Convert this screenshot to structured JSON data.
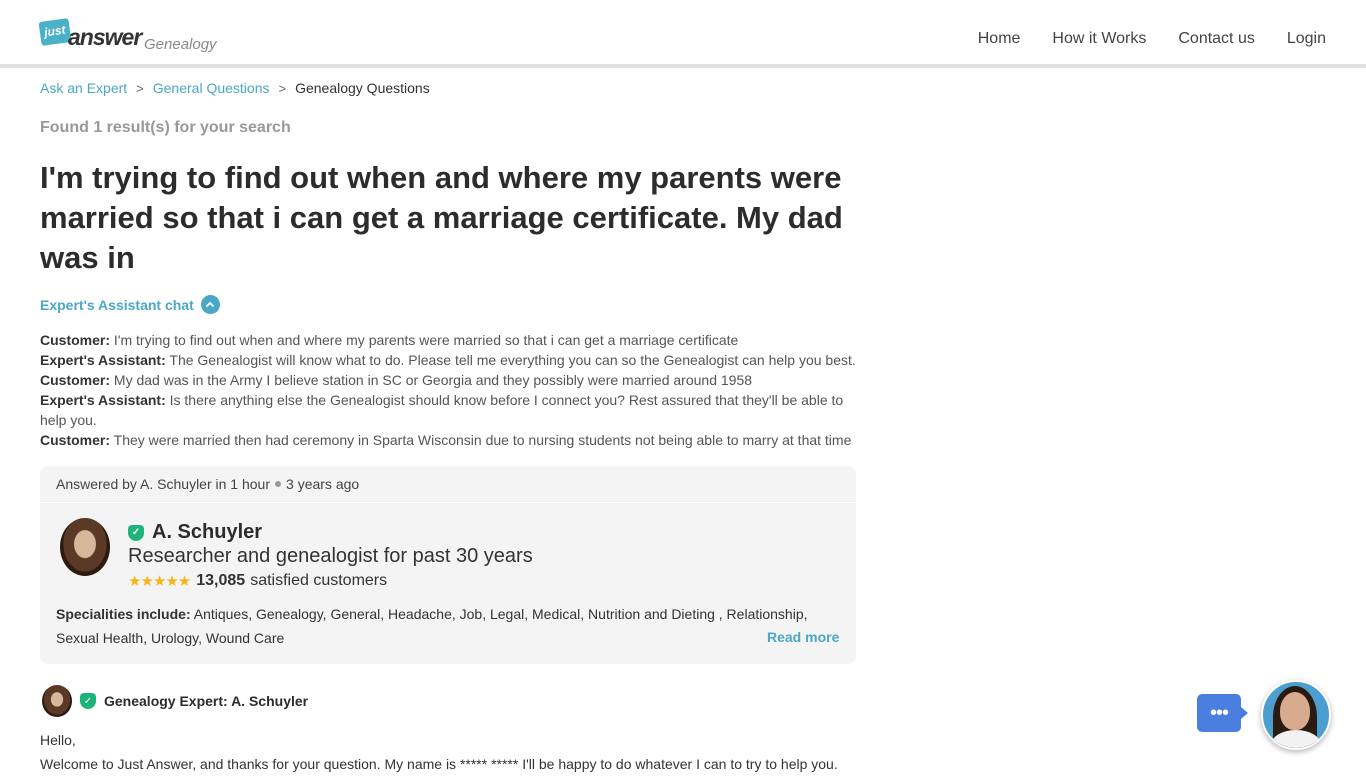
{
  "header": {
    "logo_just": "just",
    "logo_answer": "answer",
    "logo_sub": "Genealogy",
    "nav": [
      "Home",
      "How it Works",
      "Contact us",
      "Login"
    ]
  },
  "breadcrumb": {
    "items": [
      "Ask an Expert",
      "General Questions"
    ],
    "current": "Genealogy Questions",
    "separator": ">"
  },
  "found_text": "Found 1 result(s) for your search",
  "title": "I'm trying to find out when and where my parents were married so that i can get a marriage certificate. My dad was in",
  "chat_toggle": {
    "label": "Expert's Assistant chat",
    "icon": "chevron-up-icon"
  },
  "chat": [
    {
      "speaker": "Customer:",
      "text": " I'm trying to find out when and where my parents were married so that i can get a marriage certificate"
    },
    {
      "speaker": "Expert's Assistant:",
      "text": " The Genealogist will know what to do. Please tell me everything you can so the Genealogist can help you best."
    },
    {
      "speaker": "Customer:",
      "text": " My dad was in the Army I believe station in SC or Georgia and they possibly were married around 1958"
    },
    {
      "speaker": "Expert's Assistant:",
      "text": " Is there anything else the Genealogist should know before I connect you? Rest assured that they'll be able to help you."
    },
    {
      "speaker": "Customer:",
      "text": " They were married then had ceremony in Sparta Wisconsin due to nursing students not being able to marry at that time"
    }
  ],
  "answer_card": {
    "answered_by": "Answered by A. Schuyler in 1 hour",
    "time_ago": "3 years ago",
    "expert_name": "A. Schuyler",
    "expert_tagline": "Researcher and genealogist for past 30 years",
    "rating_stars": 5,
    "stars_glyph": "★★★★★",
    "customer_count": "13,085",
    "customer_label": "satisfied customers",
    "specialities_label": "Specialities include:",
    "specialities": " Antiques, Genealogy, General, Headache, Job, Legal, Medical, Nutrition and Dieting , Relationship, Sexual Health, Urology, Wound Care",
    "read_more": "Read more"
  },
  "post": {
    "author": "Genealogy Expert: A. Schuyler",
    "lines": [
      "Hello,",
      "Welcome to Just Answer, and thanks for your question. My name is ***** ***** I'll be happy to do whatever I can to try to help you."
    ]
  },
  "colors": {
    "accent": "#4aa8c6",
    "verified": "#1db37a",
    "star": "#f6b619",
    "chat_button": "#4a7fe0"
  }
}
